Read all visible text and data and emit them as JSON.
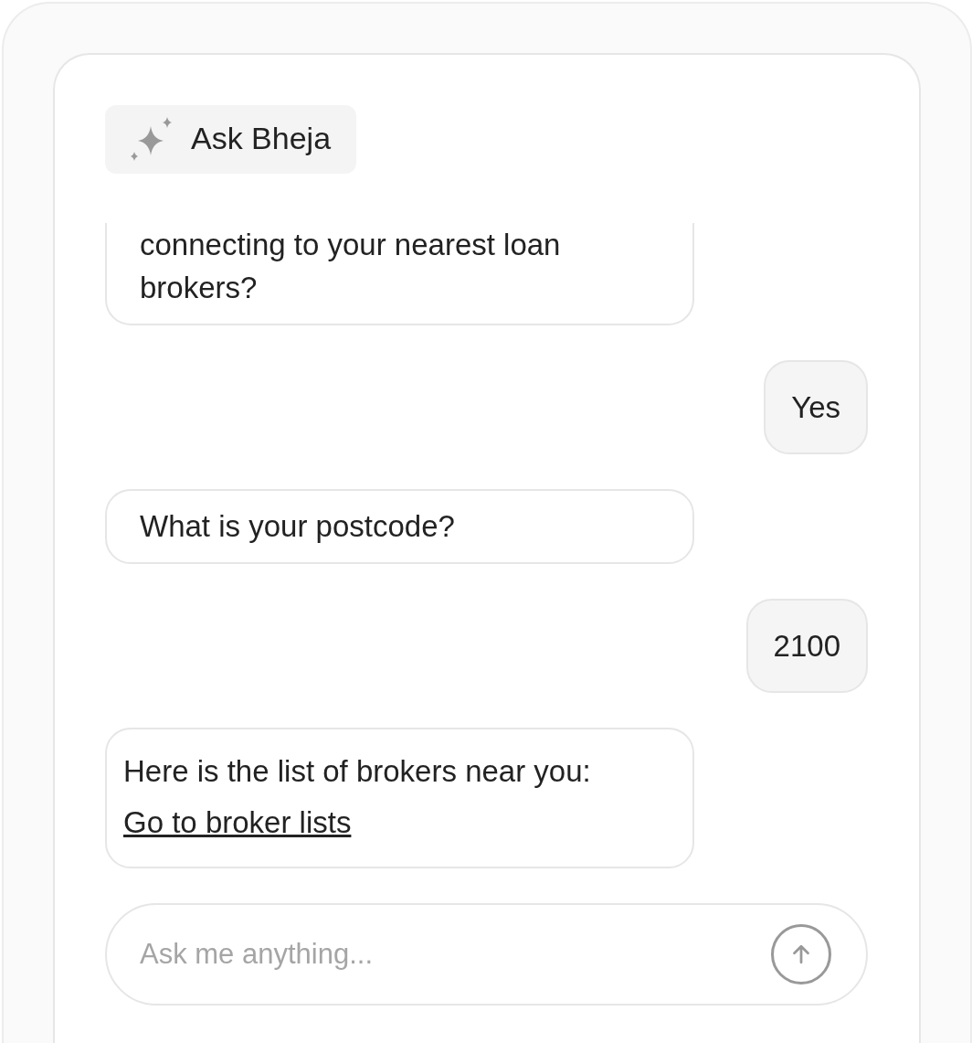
{
  "header": {
    "title": "Ask Bheja"
  },
  "messages": [
    {
      "kind": "bot",
      "text": "connecting to your nearest loan brokers?",
      "cut_top": true
    },
    {
      "kind": "user",
      "text": "Yes"
    },
    {
      "kind": "bot",
      "text": "What is your postcode?"
    },
    {
      "kind": "user",
      "text": "2100"
    },
    {
      "kind": "bot",
      "text": "Here is the list of brokers near you:",
      "link": "Go to broker lists"
    }
  ],
  "composer": {
    "placeholder": "Ask me anything..."
  }
}
